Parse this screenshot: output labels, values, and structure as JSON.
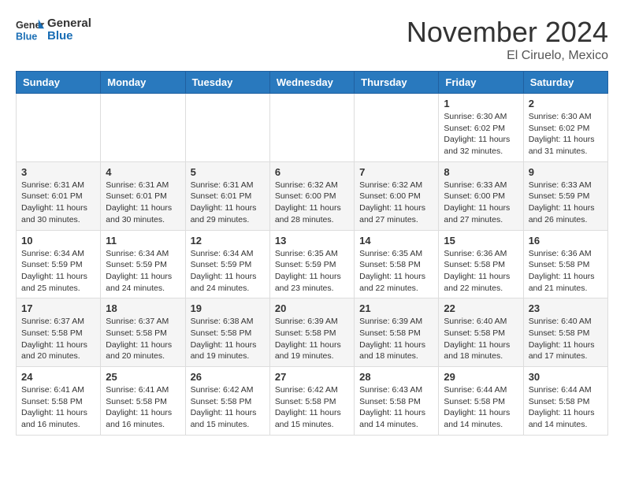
{
  "header": {
    "logo_text_general": "General",
    "logo_text_blue": "Blue",
    "month_title": "November 2024",
    "location": "El Ciruelo, Mexico"
  },
  "calendar": {
    "days_of_week": [
      "Sunday",
      "Monday",
      "Tuesday",
      "Wednesday",
      "Thursday",
      "Friday",
      "Saturday"
    ],
    "weeks": [
      [
        {
          "day": "",
          "info": ""
        },
        {
          "day": "",
          "info": ""
        },
        {
          "day": "",
          "info": ""
        },
        {
          "day": "",
          "info": ""
        },
        {
          "day": "",
          "info": ""
        },
        {
          "day": "1",
          "info": "Sunrise: 6:30 AM\nSunset: 6:02 PM\nDaylight: 11 hours and 32 minutes."
        },
        {
          "day": "2",
          "info": "Sunrise: 6:30 AM\nSunset: 6:02 PM\nDaylight: 11 hours and 31 minutes."
        }
      ],
      [
        {
          "day": "3",
          "info": "Sunrise: 6:31 AM\nSunset: 6:01 PM\nDaylight: 11 hours and 30 minutes."
        },
        {
          "day": "4",
          "info": "Sunrise: 6:31 AM\nSunset: 6:01 PM\nDaylight: 11 hours and 30 minutes."
        },
        {
          "day": "5",
          "info": "Sunrise: 6:31 AM\nSunset: 6:01 PM\nDaylight: 11 hours and 29 minutes."
        },
        {
          "day": "6",
          "info": "Sunrise: 6:32 AM\nSunset: 6:00 PM\nDaylight: 11 hours and 28 minutes."
        },
        {
          "day": "7",
          "info": "Sunrise: 6:32 AM\nSunset: 6:00 PM\nDaylight: 11 hours and 27 minutes."
        },
        {
          "day": "8",
          "info": "Sunrise: 6:33 AM\nSunset: 6:00 PM\nDaylight: 11 hours and 27 minutes."
        },
        {
          "day": "9",
          "info": "Sunrise: 6:33 AM\nSunset: 5:59 PM\nDaylight: 11 hours and 26 minutes."
        }
      ],
      [
        {
          "day": "10",
          "info": "Sunrise: 6:34 AM\nSunset: 5:59 PM\nDaylight: 11 hours and 25 minutes."
        },
        {
          "day": "11",
          "info": "Sunrise: 6:34 AM\nSunset: 5:59 PM\nDaylight: 11 hours and 24 minutes."
        },
        {
          "day": "12",
          "info": "Sunrise: 6:34 AM\nSunset: 5:59 PM\nDaylight: 11 hours and 24 minutes."
        },
        {
          "day": "13",
          "info": "Sunrise: 6:35 AM\nSunset: 5:59 PM\nDaylight: 11 hours and 23 minutes."
        },
        {
          "day": "14",
          "info": "Sunrise: 6:35 AM\nSunset: 5:58 PM\nDaylight: 11 hours and 22 minutes."
        },
        {
          "day": "15",
          "info": "Sunrise: 6:36 AM\nSunset: 5:58 PM\nDaylight: 11 hours and 22 minutes."
        },
        {
          "day": "16",
          "info": "Sunrise: 6:36 AM\nSunset: 5:58 PM\nDaylight: 11 hours and 21 minutes."
        }
      ],
      [
        {
          "day": "17",
          "info": "Sunrise: 6:37 AM\nSunset: 5:58 PM\nDaylight: 11 hours and 20 minutes."
        },
        {
          "day": "18",
          "info": "Sunrise: 6:37 AM\nSunset: 5:58 PM\nDaylight: 11 hours and 20 minutes."
        },
        {
          "day": "19",
          "info": "Sunrise: 6:38 AM\nSunset: 5:58 PM\nDaylight: 11 hours and 19 minutes."
        },
        {
          "day": "20",
          "info": "Sunrise: 6:39 AM\nSunset: 5:58 PM\nDaylight: 11 hours and 19 minutes."
        },
        {
          "day": "21",
          "info": "Sunrise: 6:39 AM\nSunset: 5:58 PM\nDaylight: 11 hours and 18 minutes."
        },
        {
          "day": "22",
          "info": "Sunrise: 6:40 AM\nSunset: 5:58 PM\nDaylight: 11 hours and 18 minutes."
        },
        {
          "day": "23",
          "info": "Sunrise: 6:40 AM\nSunset: 5:58 PM\nDaylight: 11 hours and 17 minutes."
        }
      ],
      [
        {
          "day": "24",
          "info": "Sunrise: 6:41 AM\nSunset: 5:58 PM\nDaylight: 11 hours and 16 minutes."
        },
        {
          "day": "25",
          "info": "Sunrise: 6:41 AM\nSunset: 5:58 PM\nDaylight: 11 hours and 16 minutes."
        },
        {
          "day": "26",
          "info": "Sunrise: 6:42 AM\nSunset: 5:58 PM\nDaylight: 11 hours and 15 minutes."
        },
        {
          "day": "27",
          "info": "Sunrise: 6:42 AM\nSunset: 5:58 PM\nDaylight: 11 hours and 15 minutes."
        },
        {
          "day": "28",
          "info": "Sunrise: 6:43 AM\nSunset: 5:58 PM\nDaylight: 11 hours and 14 minutes."
        },
        {
          "day": "29",
          "info": "Sunrise: 6:44 AM\nSunset: 5:58 PM\nDaylight: 11 hours and 14 minutes."
        },
        {
          "day": "30",
          "info": "Sunrise: 6:44 AM\nSunset: 5:58 PM\nDaylight: 11 hours and 14 minutes."
        }
      ]
    ]
  }
}
